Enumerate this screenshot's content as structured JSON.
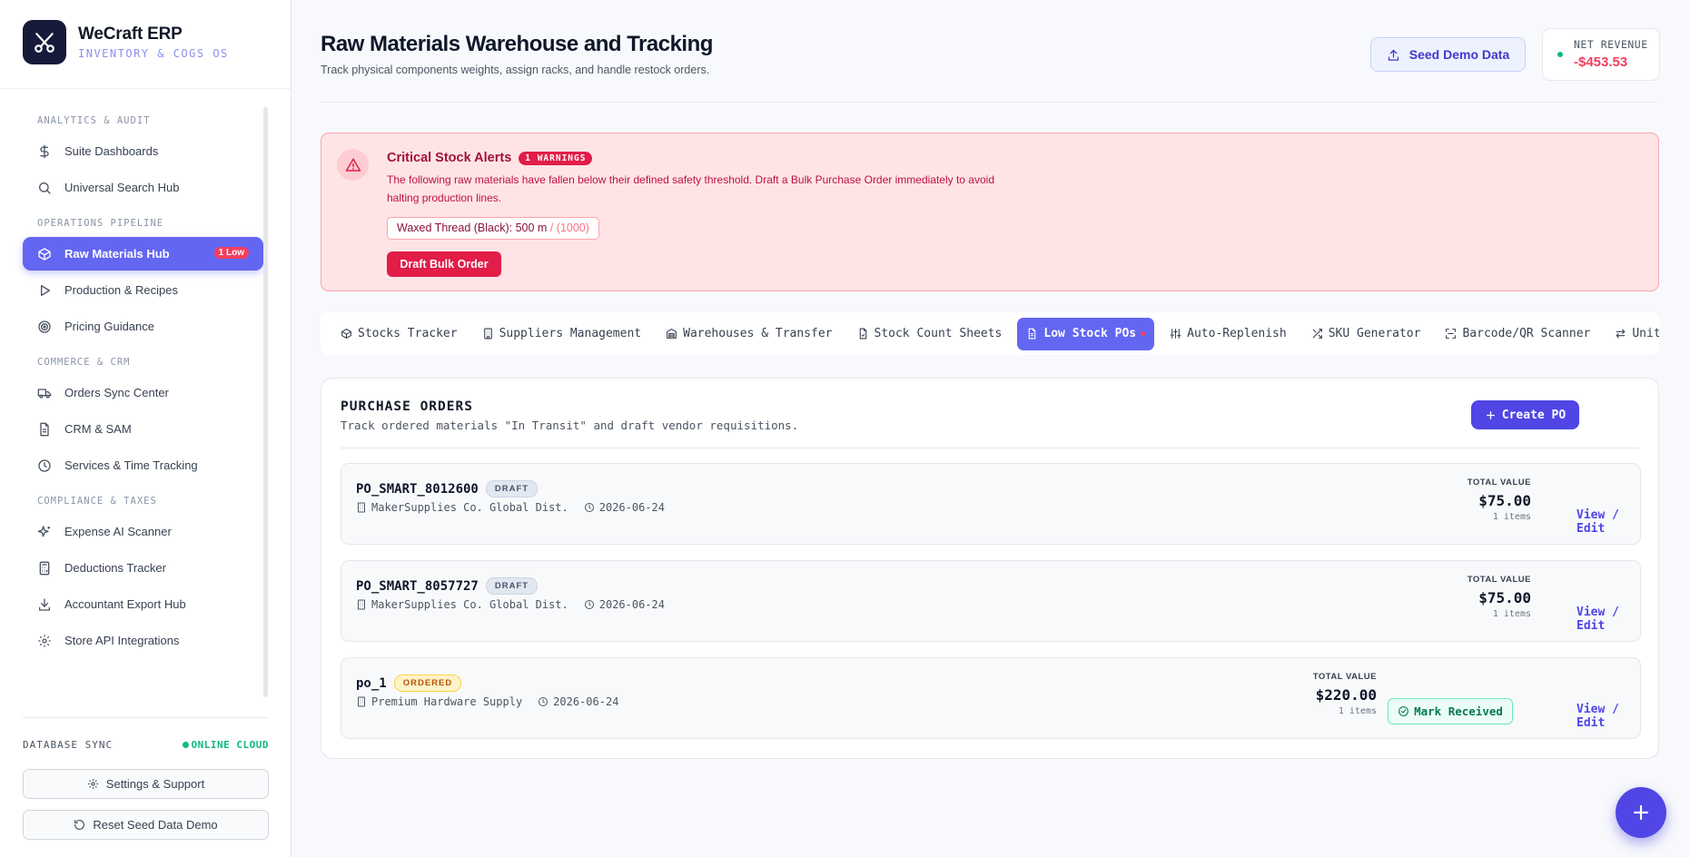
{
  "brand": {
    "name": "WeCraft ERP",
    "subtitle": "INVENTORY & COGS OS"
  },
  "sidebar": {
    "sections": [
      {
        "title": "ANALYTICS & AUDIT",
        "items": [
          {
            "label": "Suite Dashboards",
            "icon": "dollar-icon"
          },
          {
            "label": "Universal Search Hub",
            "icon": "search-icon"
          }
        ]
      },
      {
        "title": "OPERATIONS PIPELINE",
        "items": [
          {
            "label": "Raw Materials Hub",
            "icon": "box-icon",
            "active": true,
            "badge": "1 Low"
          },
          {
            "label": "Production & Recipes",
            "icon": "play-icon"
          },
          {
            "label": "Pricing Guidance",
            "icon": "target-icon"
          }
        ]
      },
      {
        "title": "COMMERCE & CRM",
        "items": [
          {
            "label": "Orders Sync Center",
            "icon": "truck-icon"
          },
          {
            "label": "CRM & SAM",
            "icon": "document-icon"
          },
          {
            "label": "Services & Time Tracking",
            "icon": "clock-icon"
          }
        ]
      },
      {
        "title": "COMPLIANCE & TAXES",
        "items": [
          {
            "label": "Expense AI Scanner",
            "icon": "sparkle-icon"
          },
          {
            "label": "Deductions Tracker",
            "icon": "calculator-icon"
          },
          {
            "label": "Accountant Export Hub",
            "icon": "download-icon"
          },
          {
            "label": "Store API Integrations",
            "icon": "gear-icon"
          }
        ]
      }
    ],
    "db_sync_label": "DATABASE SYNC",
    "db_sync_status": "ONLINE CLOUD",
    "settings_label": "Settings & Support",
    "reset_label": "Reset Seed Data Demo"
  },
  "header": {
    "title": "Raw Materials Warehouse and Tracking",
    "subtitle": "Track physical components weights, assign racks, and handle restock orders.",
    "seed_label": "Seed Demo Data",
    "revenue_label": "NET REVENUE",
    "revenue_value": "-$453.53"
  },
  "alert": {
    "title": "Critical Stock Alerts",
    "badge": "1 WARNINGS",
    "text": "The following raw materials have fallen below their defined safety threshold. Draft a Bulk Purchase Order immediately to avoid halting production lines.",
    "item_name": "Waxed Thread (Black): 500 m",
    "item_threshold": " / (1000)",
    "button": "Draft Bulk Order"
  },
  "tabs": [
    {
      "label": "Stocks Tracker",
      "icon": "cube-icon"
    },
    {
      "label": "Suppliers Management",
      "icon": "building-icon"
    },
    {
      "label": "Warehouses & Transfer",
      "icon": "warehouse-icon"
    },
    {
      "label": "Stock Count Sheets",
      "icon": "file-icon"
    },
    {
      "label": "Low Stock POs",
      "icon": "file-text-icon",
      "active": true
    },
    {
      "label": "Auto-Replenish",
      "icon": "sliders-icon"
    },
    {
      "label": "SKU Generator",
      "icon": "shuffle-icon"
    },
    {
      "label": "Barcode/QR Scanner",
      "icon": "scan-icon"
    },
    {
      "label": "Unit Converter",
      "icon": "swap-icon"
    }
  ],
  "purchase_orders": {
    "title": "PURCHASE ORDERS",
    "subtitle": "Track ordered materials \"In Transit\" and draft vendor requisitions.",
    "create_label": "Create PO",
    "total_label": "TOTAL VALUE",
    "view_label": "View / Edit",
    "mark_label": "Mark Received",
    "rows": [
      {
        "id": "PO_SMART_8012600",
        "status": "DRAFT",
        "supplier": "MakerSupplies Co. Global Dist.",
        "date": "2026-06-24",
        "total": "$75.00",
        "items": "1 items"
      },
      {
        "id": "PO_SMART_8057727",
        "status": "DRAFT",
        "supplier": "MakerSupplies Co. Global Dist.",
        "date": "2026-06-24",
        "total": "$75.00",
        "items": "1 items"
      },
      {
        "id": "po_1",
        "status": "ORDERED",
        "supplier": "Premium Hardware Supply",
        "date": "2026-06-24",
        "total": "$220.00",
        "items": "1 items"
      }
    ]
  }
}
